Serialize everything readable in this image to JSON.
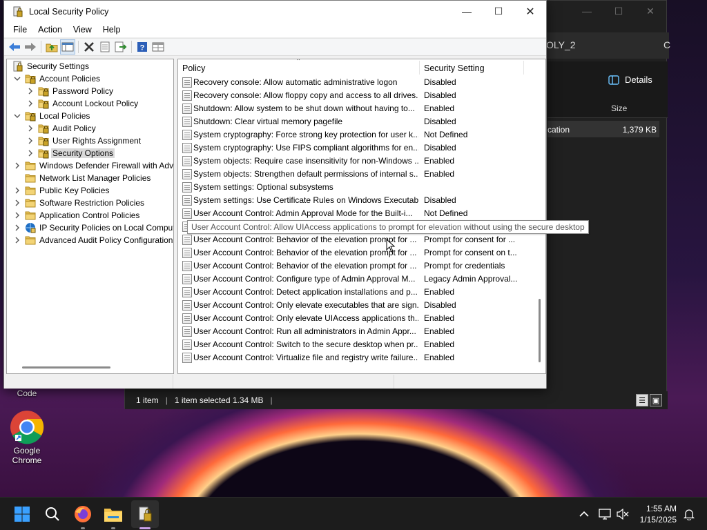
{
  "window": {
    "title": "Local Security Policy",
    "minimize_icon": "minimize-icon",
    "maximize_icon": "maximize-icon",
    "close_icon": "close-icon"
  },
  "menu": [
    "File",
    "Action",
    "View",
    "Help"
  ],
  "toolbar": [
    "back-arrow-icon",
    "forward-arrow-icon",
    "up-folder-icon",
    "show-hide-tree-icon",
    "delete-icon",
    "properties-icon",
    "export-list-icon",
    "help-icon",
    "mmc-icon"
  ],
  "tree": [
    {
      "label": "Security Settings",
      "level": 0,
      "expander": "",
      "icon": "shield"
    },
    {
      "label": "Account Policies",
      "level": 1,
      "expander": "v",
      "icon": "folder-lock"
    },
    {
      "label": "Password Policy",
      "level": 2,
      "expander": ">",
      "icon": "folder-lock"
    },
    {
      "label": "Account Lockout Policy",
      "level": 2,
      "expander": ">",
      "icon": "folder-lock"
    },
    {
      "label": "Local Policies",
      "level": 1,
      "expander": "v",
      "icon": "folder-lock"
    },
    {
      "label": "Audit Policy",
      "level": 2,
      "expander": ">",
      "icon": "folder-lock"
    },
    {
      "label": "User Rights Assignment",
      "level": 2,
      "expander": ">",
      "icon": "folder-lock"
    },
    {
      "label": "Security Options",
      "level": 2,
      "expander": ">",
      "icon": "folder-lock",
      "selected": true
    },
    {
      "label": "Windows Defender Firewall with Adva",
      "level": 1,
      "expander": ">",
      "icon": "folder"
    },
    {
      "label": "Network List Manager Policies",
      "level": 1,
      "expander": "",
      "icon": "folder"
    },
    {
      "label": "Public Key Policies",
      "level": 1,
      "expander": ">",
      "icon": "folder"
    },
    {
      "label": "Software Restriction Policies",
      "level": 1,
      "expander": ">",
      "icon": "folder"
    },
    {
      "label": "Application Control Policies",
      "level": 1,
      "expander": ">",
      "icon": "folder"
    },
    {
      "label": "IP Security Policies on Local Compute",
      "level": 1,
      "expander": ">",
      "icon": "ipsec"
    },
    {
      "label": "Advanced Audit Policy Configuration",
      "level": 1,
      "expander": ">",
      "icon": "folder"
    }
  ],
  "list_header": {
    "policy": "Policy",
    "setting": "Security Setting"
  },
  "policies": [
    {
      "name": "Recovery console: Allow automatic administrative logon",
      "setting": "Disabled"
    },
    {
      "name": "Recovery console: Allow floppy copy and access to all drives...",
      "setting": "Disabled"
    },
    {
      "name": "Shutdown: Allow system to be shut down without having to...",
      "setting": "Enabled"
    },
    {
      "name": "Shutdown: Clear virtual memory pagefile",
      "setting": "Disabled"
    },
    {
      "name": "System cryptography: Force strong key protection for user k...",
      "setting": "Not Defined"
    },
    {
      "name": "System cryptography: Use FIPS compliant algorithms for en...",
      "setting": "Disabled"
    },
    {
      "name": "System objects: Require case insensitivity for non-Windows ...",
      "setting": "Enabled"
    },
    {
      "name": "System objects: Strengthen default permissions of internal s...",
      "setting": "Enabled"
    },
    {
      "name": "System settings: Optional subsystems",
      "setting": ""
    },
    {
      "name": "System settings: Use Certificate Rules on Windows Executabl...",
      "setting": "Disabled"
    },
    {
      "name": "User Account Control: Admin Approval Mode for the Built-i...",
      "setting": "Not Defined"
    },
    {
      "name": "User Account Control: Allow UIAccess applications to prompt for elevation without using the secure desktop",
      "setting": "",
      "hover": true
    },
    {
      "name": "User Account Control: Behavior of the elevation prompt for ...",
      "setting": "Prompt for consent for ..."
    },
    {
      "name": "User Account Control: Behavior of the elevation prompt for ...",
      "setting": "Prompt for consent on t..."
    },
    {
      "name": "User Account Control: Behavior of the elevation prompt for ...",
      "setting": "Prompt for credentials"
    },
    {
      "name": "User Account Control: Configure type of Admin Approval M...",
      "setting": "Legacy Admin Approval..."
    },
    {
      "name": "User Account Control: Detect application installations and p...",
      "setting": "Enabled"
    },
    {
      "name": "User Account Control: Only elevate executables that are sign...",
      "setting": "Disabled"
    },
    {
      "name": "User Account Control: Only elevate UIAccess applications th...",
      "setting": "Enabled"
    },
    {
      "name": "User Account Control: Run all administrators in Admin Appr...",
      "setting": "Enabled"
    },
    {
      "name": "User Account Control: Switch to the secure desktop when pr...",
      "setting": "Enabled"
    },
    {
      "name": "User Account Control: Virtualize file and registry write failure...",
      "setting": "Enabled"
    }
  ],
  "tooltip": "User Account Control: Allow UIAccess applications to prompt for elevation without using the secure desktop",
  "explorer": {
    "tab_text": "OLY_2",
    "tab_edge": "C",
    "details_label": "Details",
    "size_header": "Size",
    "row_name": "cation",
    "row_size": "1,379 KB",
    "status_items": "1 item",
    "status_selected": "1 item selected  1.34 MB",
    "status_sep": "|"
  },
  "desktop_icons": [
    {
      "label": "Code",
      "icon": "vscode-icon"
    },
    {
      "label": "Google Chrome",
      "icon": "chrome-icon"
    }
  ],
  "taskbar": {
    "apps": [
      "start-icon",
      "search-icon",
      "firefox-icon",
      "file-explorer-icon",
      "security-policy-icon"
    ],
    "time": "1:55 AM",
    "date": "1/15/2025",
    "tray": [
      "chevron-up-icon",
      "network-icon",
      "volume-muted-icon",
      "notification-icon"
    ]
  },
  "colors": {
    "selected_tree": "#d9d9d9",
    "taskbar": "#1c1c1c",
    "folder": "#e8c35a",
    "accent": "#0078d4"
  }
}
